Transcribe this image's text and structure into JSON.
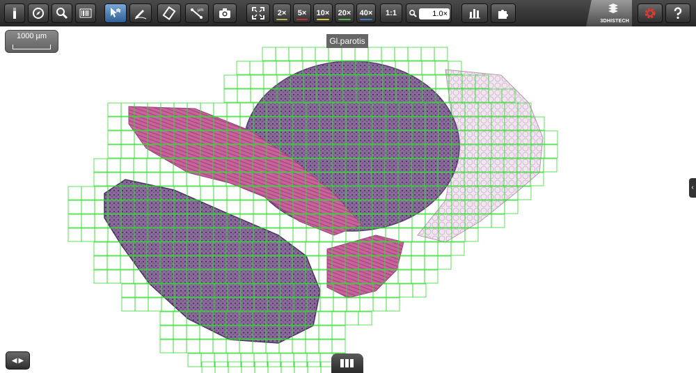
{
  "toolbar": {
    "tools": [
      {
        "name": "slide-icon"
      },
      {
        "name": "compass-icon"
      },
      {
        "name": "magnifier-icon"
      },
      {
        "name": "barcode-icon"
      },
      {
        "name": "pointer-hand-icon",
        "active": true
      },
      {
        "name": "annotate-pen-icon"
      },
      {
        "name": "rotate-icon"
      },
      {
        "name": "measure-icon"
      },
      {
        "name": "camera-icon"
      },
      {
        "name": "fullscreen-icon"
      }
    ],
    "zoom_levels": [
      {
        "label": "2×",
        "color": "#b7b24a"
      },
      {
        "label": "5×",
        "color": "#c23030"
      },
      {
        "label": "10×",
        "color": "#d8c23a"
      },
      {
        "label": "20×",
        "color": "#4fb24f"
      },
      {
        "label": "40×",
        "color": "#3b78c8"
      }
    ],
    "one_to_one_label": "1:1",
    "zoom_value": "1.0×",
    "logo_text": "3DHISTECH",
    "settings_color": "#e03a2a"
  },
  "viewer": {
    "scale_label": "1000 µm",
    "region_label": "Gl.parotis",
    "grid_color": "#33dd33"
  }
}
